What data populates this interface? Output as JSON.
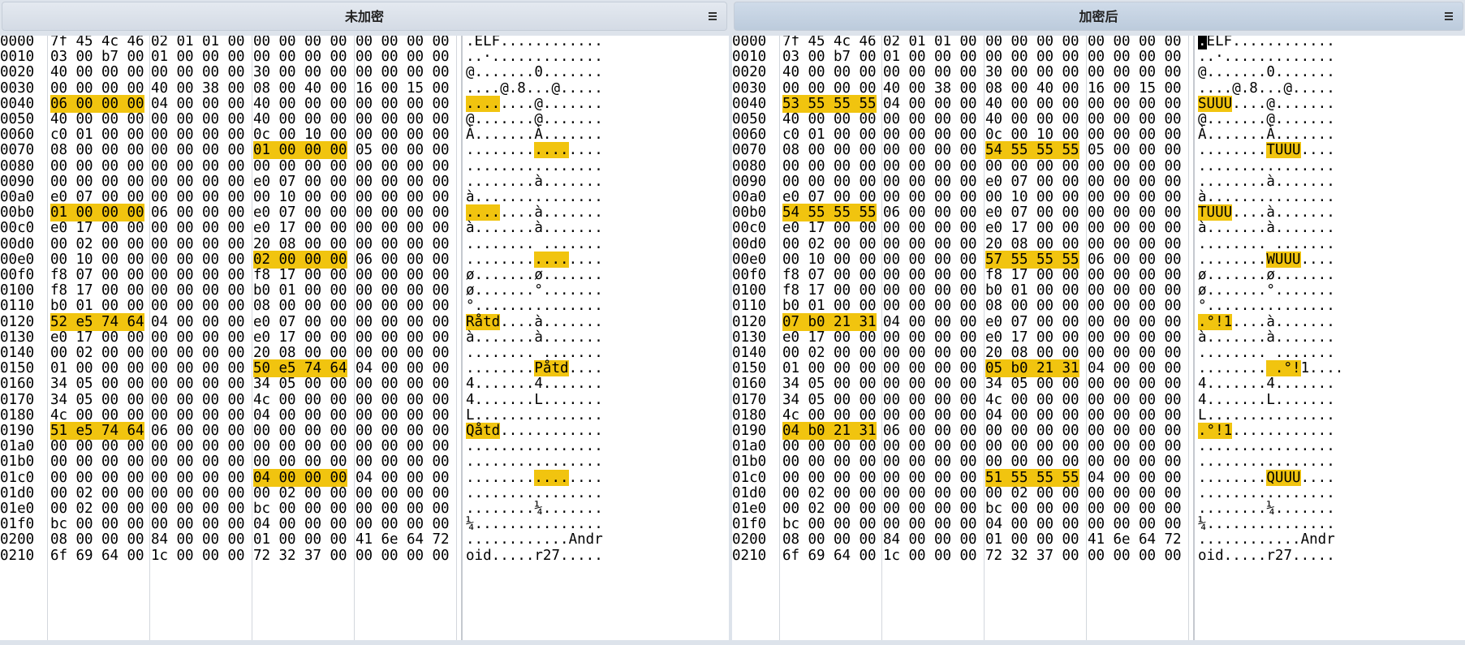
{
  "panes": [
    {
      "id": "left",
      "title": "未加密",
      "menu_icon": "hamburger-menu-icon",
      "rows": [
        {
          "a": "0000",
          "h": "7f454c46020101000000000000000000",
          "t": ".ELF............"
        },
        {
          "a": "0010",
          "h": "0300b700010000000000000000000000",
          "t": "..·............."
        },
        {
          "a": "0020",
          "h": "40000000000000003000000000000000",
          "t": "@.......0......."
        },
        {
          "a": "0030",
          "h": "00000000400038000800400016001500",
          "t": "....@.8...@....."
        },
        {
          "a": "0040",
          "h": "06000000040000004000000000000000",
          "t": "........@.......",
          "hb": [
            0,
            1,
            2,
            3
          ]
        },
        {
          "a": "0050",
          "h": "40000000000000004000000000000000",
          "t": "@.......@......."
        },
        {
          "a": "0060",
          "h": "c0010000000000000c00100000000000",
          "t": "À.......À......."
        },
        {
          "a": "0070",
          "h": "08000000000000000100000005000000",
          "t": "................",
          "hb": [
            8,
            9,
            10,
            11
          ]
        },
        {
          "a": "0080",
          "h": "00000000000000000000000000000000",
          "t": "................"
        },
        {
          "a": "0090",
          "h": "0000000000000000e007000000000000",
          "t": "........à......."
        },
        {
          "a": "00a0",
          "h": "e0070000000000000010000000000000",
          "t": "à..............."
        },
        {
          "a": "00b0",
          "h": "0100000006000000e007000000000000",
          "t": "........à.......",
          "hb": [
            0,
            1,
            2,
            3
          ]
        },
        {
          "a": "00c0",
          "h": "e017000000000000e017000000000000",
          "t": "à.......à......."
        },
        {
          "a": "00d0",
          "h": "00020000000000002008000000000000",
          "t": "........ ......."
        },
        {
          "a": "00e0",
          "h": "00100000000000000200000006000000",
          "t": "................",
          "hb": [
            8,
            9,
            10,
            11
          ]
        },
        {
          "a": "00f0",
          "h": "f807000000000000f817000000000000",
          "t": "ø.......ø......."
        },
        {
          "a": "0100",
          "h": "f817000000000000b001000000000000",
          "t": "ø.......°......."
        },
        {
          "a": "0110",
          "h": "b0010000000000000800000000000000",
          "t": "°..............."
        },
        {
          "a": "0120",
          "h": "52e5746404000000e007000000000000",
          "t": "Råtd....à.......",
          "hb": [
            0,
            1,
            2,
            3
          ]
        },
        {
          "a": "0130",
          "h": "e017000000000000e017000000000000",
          "t": "à.......à......."
        },
        {
          "a": "0140",
          "h": "00020000000000002008000000000000",
          "t": "........ ......."
        },
        {
          "a": "0150",
          "h": "010000000000000050e5746404000000",
          "t": "........Påtd....",
          "hb": [
            8,
            9,
            10,
            11
          ]
        },
        {
          "a": "0160",
          "h": "34050000000000003405000000000000",
          "t": "4.......4......."
        },
        {
          "a": "0170",
          "h": "34050000000000004c00000000000000",
          "t": "4.......L......."
        },
        {
          "a": "0180",
          "h": "4c000000000000000400000000000000",
          "t": "L..............."
        },
        {
          "a": "0190",
          "h": "51e5746406000000000000000000000",
          "t": "Qåtd............",
          "hb": [
            0,
            1,
            2,
            3
          ]
        },
        {
          "a": "01a0",
          "h": "00000000000000000000000000000000",
          "t": "................"
        },
        {
          "a": "01b0",
          "h": "00000000000000000000000000000000",
          "t": "................"
        },
        {
          "a": "01c0",
          "h": "00000000000000000400000004000000",
          "t": "................",
          "hb": [
            8,
            9,
            10,
            11
          ]
        },
        {
          "a": "01d0",
          "h": "00020000000000000002000000000000",
          "t": "................"
        },
        {
          "a": "01e0",
          "h": "0002000000000000bc00000000000000",
          "t": "........¼......."
        },
        {
          "a": "01f0",
          "h": "bc000000000000000400000000000000",
          "t": "¼..............."
        },
        {
          "a": "0200",
          "h": "080000008400000001000000416e6472",
          "t": "............Andr"
        },
        {
          "a": "0210",
          "h": "6f696400 1c000000723237000000000",
          "t": "oid.....r27....."
        }
      ]
    },
    {
      "id": "right",
      "title": "加密后",
      "menu_icon": "hamburger-menu-icon",
      "rows": [
        {
          "a": "0000",
          "h": "7f454c46020101000000000000000000",
          "t": ".ELF............",
          "cursor": 0
        },
        {
          "a": "0010",
          "h": "0300b700010000000000000000000000",
          "t": "..·............."
        },
        {
          "a": "0020",
          "h": "40000000000000003000000000000000",
          "t": "@.......0......."
        },
        {
          "a": "0030",
          "h": "00000000400038000800400016001500",
          "t": "....@.8...@....."
        },
        {
          "a": "0040",
          "h": "53555555040000004000000000000000",
          "t": "SUUU....@.......",
          "hb": [
            0,
            1,
            2,
            3
          ]
        },
        {
          "a": "0050",
          "h": "40000000000000004000000000000000",
          "t": "@.......@......."
        },
        {
          "a": "0060",
          "h": "c0010000000000000c00100000000000",
          "t": "À.......À......."
        },
        {
          "a": "0070",
          "h": "08000000000000005455555505000000",
          "t": "........TUUU....",
          "hb": [
            8,
            9,
            10,
            11
          ]
        },
        {
          "a": "0080",
          "h": "00000000000000000000000000000000",
          "t": "................"
        },
        {
          "a": "0090",
          "h": "0000000000000000e007000000000000",
          "t": "........à......."
        },
        {
          "a": "00a0",
          "h": "e0070000000000000010000000000000",
          "t": "à..............."
        },
        {
          "a": "00b0",
          "h": "5455555506000000e007000000000000",
          "t": "TUUU....à.......",
          "hb": [
            0,
            1,
            2,
            3
          ]
        },
        {
          "a": "00c0",
          "h": "e017000000000000e017000000000000",
          "t": "à.......à......."
        },
        {
          "a": "00d0",
          "h": "00020000000000002008000000000000",
          "t": "........ ......."
        },
        {
          "a": "00e0",
          "h": "00100000000000005755555506000000",
          "t": "........WUUU....",
          "hb": [
            8,
            9,
            10,
            11
          ]
        },
        {
          "a": "00f0",
          "h": "f807000000000000f817000000000000",
          "t": "ø.......ø......."
        },
        {
          "a": "0100",
          "h": "f817000000000000b001000000000000",
          "t": "ø.......°......."
        },
        {
          "a": "0110",
          "h": "b0010000000000000800000000000000",
          "t": "°..............."
        },
        {
          "a": "0120",
          "h": "07b0213104000000e007000000000000",
          "t": ".°!1....à.......",
          "hb": [
            0,
            1,
            2,
            3
          ]
        },
        {
          "a": "0130",
          "h": "e017000000000000e017000000000000",
          "t": "à.......à......."
        },
        {
          "a": "0140",
          "h": "00020000000000002008000000000000",
          "t": "........ ......."
        },
        {
          "a": "0150",
          "h": "010000000000000005b0213104000000",
          "t": "........ .°!1....",
          "hb": [
            8,
            9,
            10,
            11
          ]
        },
        {
          "a": "0160",
          "h": "34050000000000003405000000000000",
          "t": "4.......4......."
        },
        {
          "a": "0170",
          "h": "34050000000000004c00000000000000",
          "t": "4.......L......."
        },
        {
          "a": "0180",
          "h": "4c000000000000000400000000000000",
          "t": "L..............."
        },
        {
          "a": "0190",
          "h": "04b0213106000000000000000000000",
          "t": ".°!1............",
          "hb": [
            0,
            1,
            2,
            3
          ]
        },
        {
          "a": "01a0",
          "h": "00000000000000000000000000000000",
          "t": "................"
        },
        {
          "a": "01b0",
          "h": "00000000000000000000000000000000",
          "t": "................"
        },
        {
          "a": "01c0",
          "h": "00000000000000005155555504000000",
          "t": "........QUUU....",
          "hb": [
            8,
            9,
            10,
            11
          ]
        },
        {
          "a": "01d0",
          "h": "00020000000000000002000000000000",
          "t": "................"
        },
        {
          "a": "01e0",
          "h": "0002000000000000bc00000000000000",
          "t": "........¼......."
        },
        {
          "a": "01f0",
          "h": "bc000000000000000400000000000000",
          "t": "¼..............."
        },
        {
          "a": "0200",
          "h": "080000008400000001000000416e6472",
          "t": "............Andr"
        },
        {
          "a": "0210",
          "h": "6f6964001c000000723237000000000",
          "t": "oid.....r27....."
        }
      ]
    }
  ]
}
